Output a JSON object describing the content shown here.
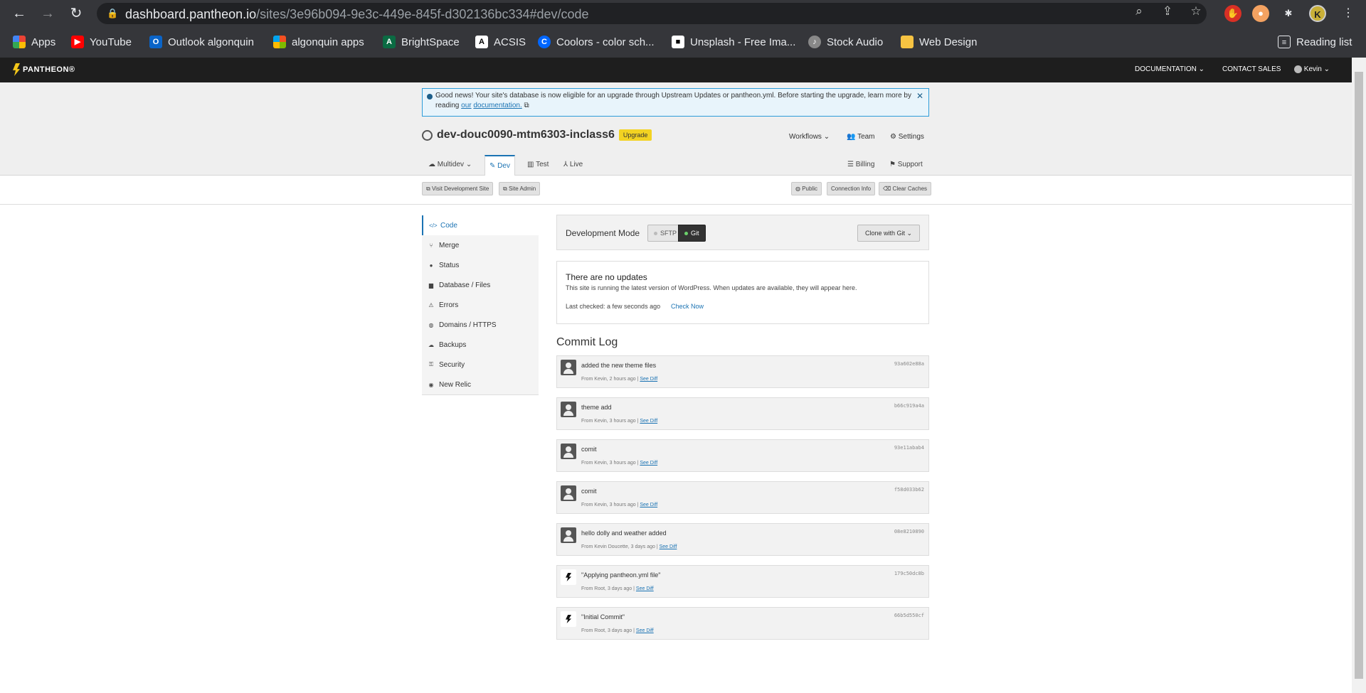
{
  "browser": {
    "url_host": "dashboard.pantheon.io",
    "url_path": "/sites/3e96b094-9e3c-449e-845f-d302136bc334#dev/code",
    "profile_initial": "K",
    "bookmarks": [
      "Apps",
      "YouTube",
      "Outlook algonquin",
      "algonquin apps",
      "BrightSpace",
      "ACSIS",
      "Coolors - color sch...",
      "Unsplash - Free Ima...",
      "Stock Audio",
      "Web Design"
    ],
    "reading_list": "Reading list"
  },
  "pantheon": {
    "logo": "PANTHEON",
    "documentation": "DOCUMENTATION",
    "contact_sales": "CONTACT SALES",
    "user": "Kevin"
  },
  "banner": {
    "text": "Good news! Your site's database is now eligible for an upgrade through Upstream Updates or pantheon.yml. Before starting the upgrade, learn more by reading",
    "link1": "our",
    "link2": "documentation."
  },
  "site": {
    "name": "dev-douc0090-mtm6303-inclass6",
    "upgrade": "Upgrade",
    "workflows": "Workflows",
    "team": "Team",
    "settings": "Settings"
  },
  "tabs": {
    "multidev": "Multidev",
    "dev": "Dev",
    "test": "Test",
    "live": "Live",
    "billing": "Billing",
    "support": "Support"
  },
  "actions": {
    "visit": "Visit Development Site",
    "admin": "Site Admin",
    "public": "Public",
    "connection": "Connection Info",
    "clear": "Clear Caches"
  },
  "sidenav": [
    "Code",
    "Merge",
    "Status",
    "Database / Files",
    "Errors",
    "Domains / HTTPS",
    "Backups",
    "Security",
    "New Relic"
  ],
  "devmode": {
    "label": "Development Mode",
    "sftp": "SFTP",
    "git": "Git",
    "clone": "Clone with Git"
  },
  "updates": {
    "title": "There are no updates",
    "desc": "This site is running the latest version of WordPress. When updates are available, they will appear here.",
    "last_checked": "Last checked: a few seconds ago",
    "check_now": "Check Now"
  },
  "commit_log_title": "Commit Log",
  "see_diff": "See Diff",
  "commits": [
    {
      "message": "added the new theme files",
      "hash": "93a602e88a",
      "meta": "From Kevin, 2 hours ago |"
    },
    {
      "message": "theme add",
      "hash": "b66c919a4a",
      "meta": "From Kevin, 3 hours ago |"
    },
    {
      "message": "comit",
      "hash": "93e11abab4",
      "meta": "From Kevin, 3 hours ago |"
    },
    {
      "message": "comit",
      "hash": "f58d033b62",
      "meta": "From Kevin, 3 hours ago |"
    },
    {
      "message": "hello dolly and weather added",
      "hash": "08e8210890",
      "meta": "From Kevin Doucette, 3 days ago |"
    },
    {
      "message": "\"Applying pantheon.yml file\"",
      "hash": "179c50dc8b",
      "meta": "From Root, 3 days ago |"
    },
    {
      "message": "\"Initial Commit\"",
      "hash": "66b5d550cf",
      "meta": "From Root, 3 days ago |"
    }
  ]
}
